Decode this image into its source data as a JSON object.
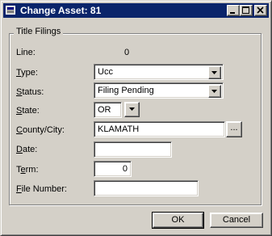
{
  "window": {
    "title": "Change Asset: 81"
  },
  "group": {
    "caption": "Title Filings"
  },
  "fields": {
    "line": {
      "label": "Line:",
      "value": "0"
    },
    "type": {
      "label_u": "T",
      "label_rest": "ype:",
      "value": "Ucc"
    },
    "status": {
      "label_u": "S",
      "label_rest": "tatus:",
      "value": "Filing Pending"
    },
    "state": {
      "label_u": "S",
      "label_rest": "tate:",
      "value": "OR"
    },
    "county": {
      "label_u": "C",
      "label_rest": "ounty/City:",
      "value": "KLAMATH",
      "browse_label": "..."
    },
    "date": {
      "label_u": "D",
      "label_rest": "ate:",
      "value": ""
    },
    "term": {
      "label_pre": "T",
      "label_u": "e",
      "label_rest": "rm:",
      "value": "0"
    },
    "file_number": {
      "label_u": "F",
      "label_rest": "ile Number:",
      "value": ""
    }
  },
  "buttons": {
    "ok": "OK",
    "cancel": "Cancel"
  },
  "icons": [
    "app-icon",
    "minimize-icon",
    "maximize-icon",
    "close-icon",
    "chevron-down-icon"
  ]
}
